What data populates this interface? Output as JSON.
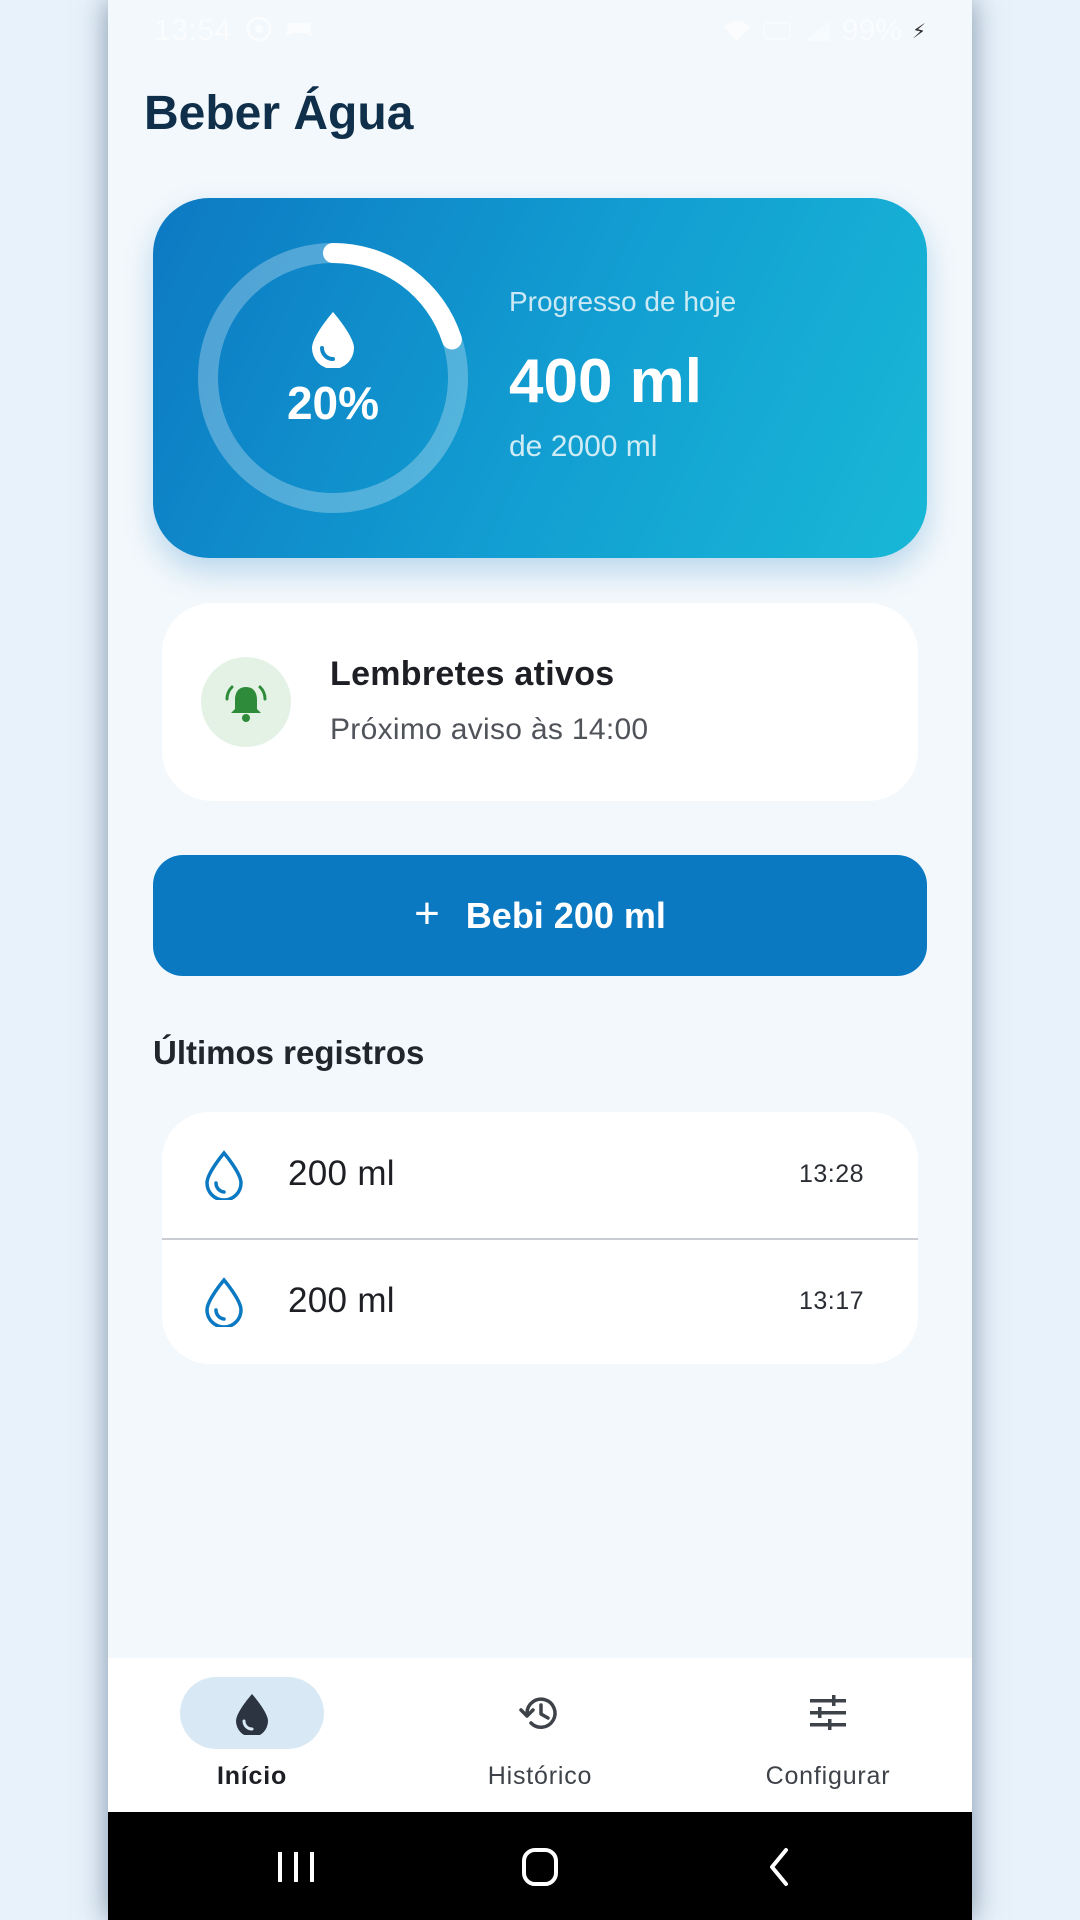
{
  "status_bar": {
    "time": "13:54",
    "battery": "99%",
    "icons": [
      "sync-icon",
      "game-controller-icon",
      "wifi-icon",
      "volte-icon",
      "signal-icon",
      "charging-icon"
    ]
  },
  "app": {
    "title": "Beber Água"
  },
  "progress": {
    "percent_label": "20%",
    "percent_value": 0.2,
    "label": "Progresso de hoje",
    "amount": "400 ml",
    "goal": "de 2000 ml"
  },
  "reminder": {
    "title": "Lembretes ativos",
    "subtitle": "Próximo aviso às 14:00",
    "icon": "alarm-bell-icon"
  },
  "drink_button": {
    "label": "Bebi 200 ml",
    "icon": "plus-icon"
  },
  "records": {
    "title": "Últimos registros",
    "items": [
      {
        "amount": "200 ml",
        "time": "13:28"
      },
      {
        "amount": "200 ml",
        "time": "13:17"
      }
    ]
  },
  "bottom_nav": {
    "items": [
      {
        "label": "Início",
        "icon": "water-drop-icon",
        "active": true
      },
      {
        "label": "Histórico",
        "icon": "history-icon",
        "active": false
      },
      {
        "label": "Configurar",
        "icon": "tune-icon",
        "active": false
      }
    ]
  },
  "colors": {
    "primary": "#0a79c2",
    "gradient_start": "#0d79c3",
    "gradient_end": "#19b8d6",
    "title": "#0f2f4a",
    "reminder_green": "#2e8b3a",
    "background": "#f3f8fc"
  }
}
